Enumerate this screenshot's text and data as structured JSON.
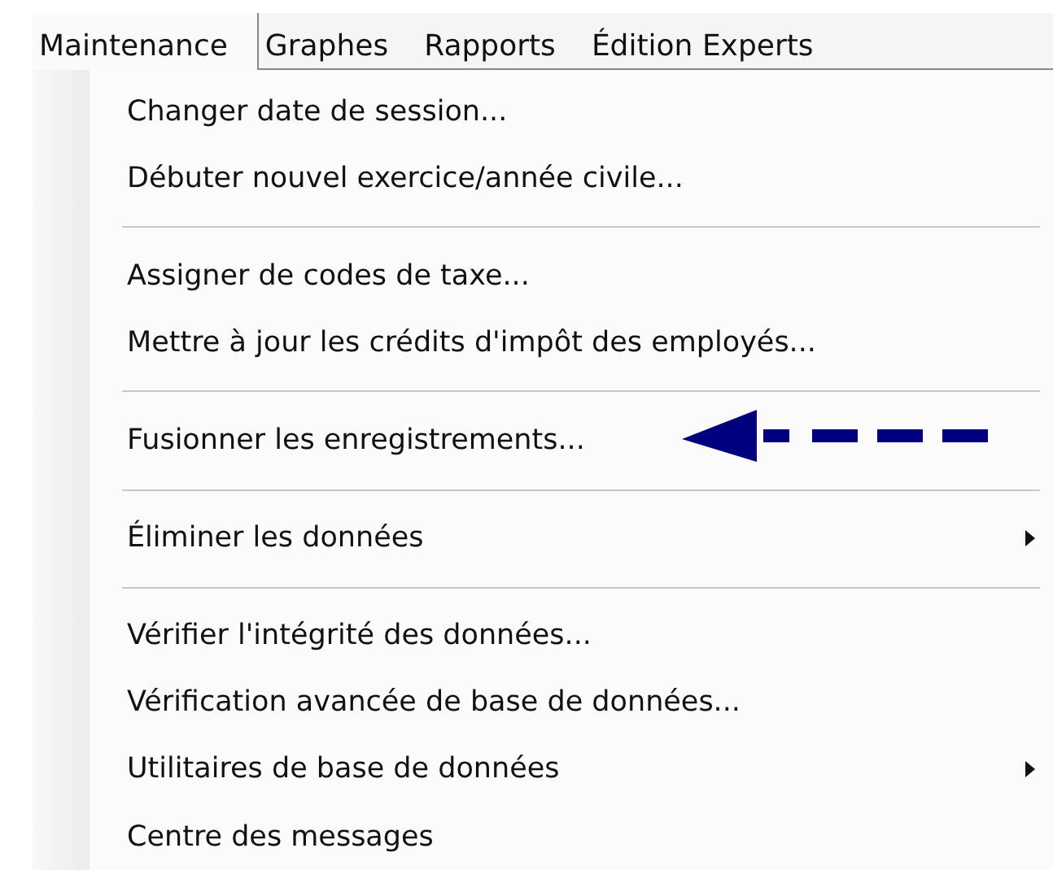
{
  "menubar": [
    {
      "label": "Maintenance",
      "selected": true
    },
    {
      "label": "Graphes",
      "selected": false
    },
    {
      "label": "Rapports",
      "selected": false
    },
    {
      "label": "Édition Experts",
      "selected": false
    }
  ],
  "menu_groups": [
    [
      {
        "label": "Changer date de session...",
        "submenu": false
      },
      {
        "label": "Débuter nouvel exercice/année civile...",
        "submenu": false
      }
    ],
    [
      {
        "label": "Assigner de codes de taxe...",
        "submenu": false
      },
      {
        "label": "Mettre à jour les crédits d'impôt des employés...",
        "submenu": false
      }
    ],
    [
      {
        "label": "Fusionner les enregistrements...",
        "submenu": false,
        "pointed": true
      }
    ],
    [
      {
        "label": "Éliminer les données",
        "submenu": true
      }
    ],
    [
      {
        "label": "Vérifier l'intégrité des données...",
        "submenu": false
      },
      {
        "label": "Vérification avancée de base de données...",
        "submenu": false
      },
      {
        "label": "Utilitaires de base de données",
        "submenu": true
      },
      {
        "label": "Centre des messages",
        "submenu": false
      }
    ]
  ]
}
